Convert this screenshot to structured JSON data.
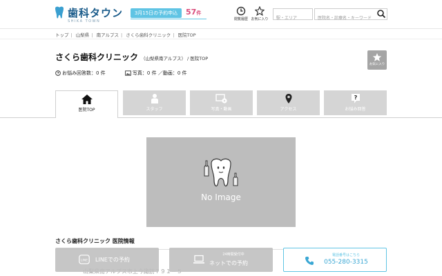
{
  "header": {
    "logo_name": "歯科タウン",
    "logo_sub": "SHIKA TOWN",
    "promo_label": "3月15日の予約申込",
    "promo_count": "57",
    "promo_unit": "件",
    "history_label": "閲覧履歴",
    "favorites_label": "お気に入り",
    "station_placeholder": "駅・エリア",
    "keyword_placeholder": "医院名・診療名・キーワード"
  },
  "breadcrumb": [
    "トップ",
    "山梨県",
    "南アルプス",
    "さくら歯科クリニック",
    "医院TOP"
  ],
  "clinic": {
    "name": "さくら歯科クリニック",
    "prefecture": "（山梨県南アルプス）",
    "page": "/ 医院TOP",
    "favorite_label": "お気に入り",
    "questions": "お悩み回答数：0 件",
    "media": "写真：0 件 ／動画：0 件"
  },
  "tabs": [
    {
      "label": "医院TOP",
      "icon": "home-icon"
    },
    {
      "label": "スタッフ",
      "icon": "staff-icon"
    },
    {
      "label": "写真・動画",
      "icon": "photo-icon"
    },
    {
      "label": "アクセス",
      "icon": "map-pin-icon"
    },
    {
      "label": "お悩み回答",
      "icon": "question-icon"
    }
  ],
  "image": {
    "no_image_text": "No Image"
  },
  "info": {
    "section_title": "さくら歯科クリニック 医院情報",
    "address": "山梨県南アルプス市上今諏訪７９１－５"
  },
  "cta": {
    "line_label": "LINEでの予約",
    "net_small": "24時間受付中",
    "net_label": "ネットでの予約",
    "tel_small": "電話番号はこちら",
    "tel_number": "055-280-3315"
  },
  "colors": {
    "brand": "#1a5b8a",
    "accent": "#5fc4e4",
    "promo_count": "#d94b7a",
    "tab_inactive": "#d5d5d5"
  }
}
